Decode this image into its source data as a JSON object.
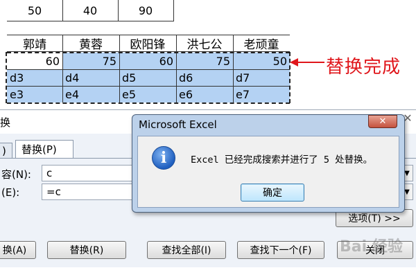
{
  "spreadsheet": {
    "top_row": [
      "50",
      "40",
      "90"
    ],
    "headers": [
      "郭靖",
      "黄蓉",
      "欧阳锋",
      "洪七公",
      "老顽童"
    ],
    "rows": [
      [
        "60",
        "75",
        "60",
        "75",
        "50"
      ],
      [
        "d3",
        "d4",
        "d5",
        "d6",
        "d7"
      ],
      [
        "e3",
        "e4",
        "e5",
        "e6",
        "e7"
      ]
    ]
  },
  "annotation": {
    "text": "替换完成",
    "color": "#e0161b"
  },
  "replace_dialog": {
    "title_fragment": "换",
    "tabs": {
      "prev_fragment": ")",
      "replace": "替换(P)"
    },
    "find_label": "容(N):",
    "find_value": "c",
    "replace_label": "(E):",
    "replace_value": "=c",
    "options_button": "选项(T) >>",
    "buttons": {
      "replace_all": "换(A)",
      "replace": "替换(R)",
      "find_all": "查找全部(I)",
      "find_next": "查找下一个(F)",
      "close": "关闭"
    }
  },
  "message_box": {
    "title": "Microsoft Excel",
    "message": "Excel 已经完成搜索并进行了 5 处替换。",
    "ok_label": "确定",
    "icon": "info-icon"
  },
  "watermark": "Bai 经验"
}
